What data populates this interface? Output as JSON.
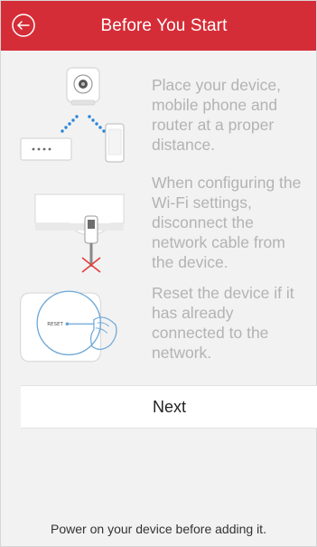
{
  "header": {
    "title": "Before You Start",
    "back_icon": "back-arrow-circle-icon",
    "bg_color": "#d52d37"
  },
  "steps": [
    {
      "illustration": "device-phone-router-illustration",
      "text": "Place your device, mobile phone and router at a proper distance."
    },
    {
      "illustration": "disconnect-cable-illustration",
      "text": "When configuring the Wi-Fi settings, disconnect the network cable from the device."
    },
    {
      "illustration": "reset-button-illustration",
      "text": "Reset the device if it has already connected to the network."
    }
  ],
  "next_button": {
    "label": "Next"
  },
  "footer": {
    "note": "Power on your device before adding it."
  }
}
